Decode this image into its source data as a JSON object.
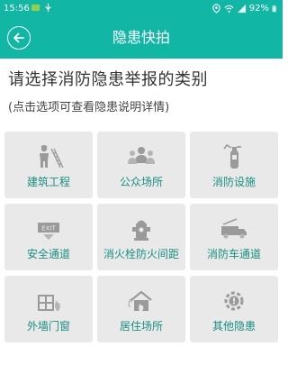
{
  "status_bar": {
    "time": "15:56",
    "battery": "92%"
  },
  "app_bar": {
    "title": "隐患快拍"
  },
  "content": {
    "heading": "请选择消防隐患举报的类别",
    "subheading": "(点击选项可查看隐患说明详情)"
  },
  "categories": [
    {
      "label": "建筑工程",
      "icon": "construction-worker-icon"
    },
    {
      "label": "公众场所",
      "icon": "crowd-icon"
    },
    {
      "label": "消防设施",
      "icon": "fire-extinguisher-icon"
    },
    {
      "label": "安全通道",
      "icon": "exit-sign-icon"
    },
    {
      "label": "消火栓防火间距",
      "icon": "fire-hydrant-icon"
    },
    {
      "label": "消防车通道",
      "icon": "fire-truck-icon"
    },
    {
      "label": "外墙门窗",
      "icon": "window-fire-icon"
    },
    {
      "label": "居住场所",
      "icon": "house-fire-icon"
    },
    {
      "label": "其他隐患",
      "icon": "gear-alert-icon"
    }
  ],
  "colors": {
    "primary": "#12b6a4",
    "tile_bg": "#e9e9e9",
    "tile_label": "#1a8f80",
    "icon_gray": "#9a9a9a"
  }
}
